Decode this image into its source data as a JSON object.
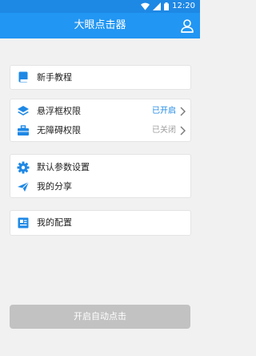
{
  "status_bar": {
    "time": "12:20"
  },
  "app_bar": {
    "title": "大眼点击器"
  },
  "menu": {
    "tutorial": {
      "label": "新手教程"
    },
    "overlay_permission": {
      "label": "悬浮框权限",
      "status": "已开启",
      "status_color": "#1e88e5"
    },
    "accessibility_permission": {
      "label": "无障碍权限",
      "status": "已关闭",
      "status_color": "#9e9e9e"
    },
    "default_settings": {
      "label": "默认参数设置"
    },
    "share": {
      "label": "我的分享"
    },
    "my_config": {
      "label": "我的配置"
    }
  },
  "start_button": {
    "label": "开启自动点击"
  },
  "colors": {
    "accent": "#2196f3",
    "status_bar": "#1e88e5",
    "icon": "#1e88e5",
    "disabled_button": "#c2c2c2"
  }
}
